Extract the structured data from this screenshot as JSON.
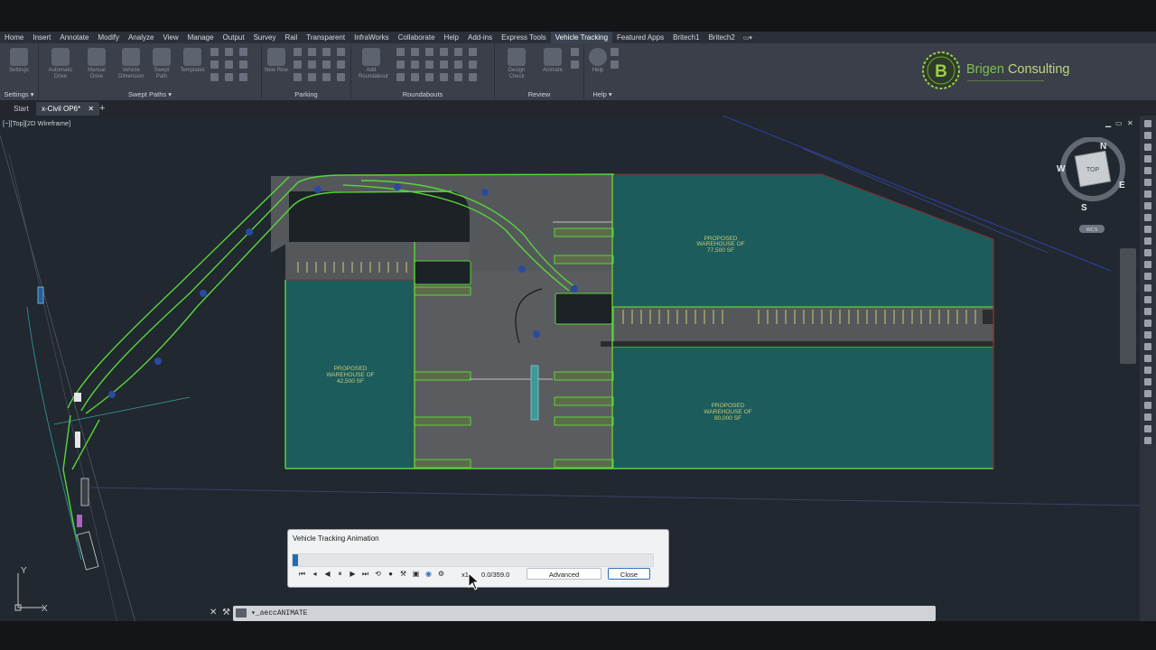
{
  "menu": {
    "items": [
      "Home",
      "Insert",
      "Annotate",
      "Modify",
      "Analyze",
      "View",
      "Manage",
      "Output",
      "Survey",
      "Rail",
      "Transparent",
      "InfraWorks",
      "Collaborate",
      "Help",
      "Add-ins",
      "Express Tools",
      "Vehicle Tracking",
      "Featured Apps",
      "Britech1",
      "Britech2"
    ],
    "active": "Vehicle Tracking"
  },
  "ribbon": {
    "panels": [
      {
        "title": "Settings ▾",
        "buttons": [
          "Settings"
        ]
      },
      {
        "title": "Swept Paths ▾",
        "buttons": [
          "Automatic Drive",
          "Manual Drive",
          "Vehicle Dimension",
          "Swept Path",
          "Templates"
        ]
      },
      {
        "title": "Parking",
        "buttons": [
          "New Row"
        ]
      },
      {
        "title": "Roundabouts",
        "buttons": [
          "Add Roundabout"
        ]
      },
      {
        "title": "Review",
        "buttons": [
          "Design Check",
          "Animate"
        ]
      },
      {
        "title": "Help ▾",
        "buttons": [
          "Help"
        ]
      }
    ]
  },
  "logo": {
    "brand": "Brigen",
    "word": "Consulting",
    "monogram": "B"
  },
  "tabs": {
    "start": "Start",
    "file": "x-Civil OP6*",
    "add": "+"
  },
  "viewport": {
    "label": "[−][Top][2D Wireframe]",
    "controls": [
      "▁",
      "▭",
      "✕"
    ],
    "viewcube": {
      "n": "N",
      "s": "S",
      "e": "E",
      "w": "W",
      "top": "TOP",
      "wcs": "WCS"
    },
    "warehouses": [
      {
        "line1": "PROPOSED",
        "line2": "WAREHOUSE  OF",
        "line3": "77,500  SF"
      },
      {
        "line1": "PROPOSED",
        "line2": "WAREHOUSE  OF",
        "line3": "42,500  SF"
      },
      {
        "line1": "PROPOSED",
        "line2": "WAREHOUSE  OF",
        "line3": "80,000  SF"
      }
    ],
    "ucs": {
      "x": "X",
      "y": "Y"
    }
  },
  "dialog": {
    "title": "Vehicle Tracking Animation",
    "progress": 0.0,
    "speed": "x1",
    "time": "0.0/359.0",
    "advanced_label": "Advanced",
    "close_label": "Close",
    "controls": [
      "skip-start",
      "step-back",
      "play-back",
      "pause",
      "play",
      "fast-forward",
      "loop",
      "record",
      "settings",
      "camera",
      "3d",
      "tools"
    ]
  },
  "command": {
    "text": "▾_aeccANIMATE"
  },
  "colors": {
    "accent": "#1f6fb5",
    "building": "#1c5c5c",
    "track": "#59d63a",
    "brand": "#7fc04a"
  }
}
